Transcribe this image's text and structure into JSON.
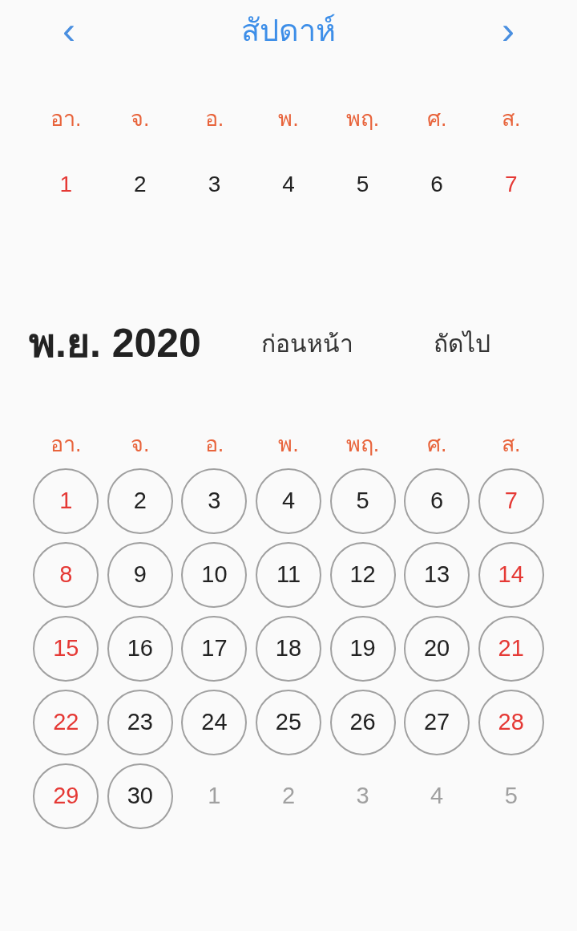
{
  "header": {
    "prev": "‹",
    "title": "สัปดาห์",
    "next": "›"
  },
  "week": {
    "weekdays": [
      "อา.",
      "จ.",
      "อ.",
      "พ.",
      "พฤ.",
      "ศ.",
      "ส."
    ],
    "days": [
      {
        "label": "1",
        "weekend": true
      },
      {
        "label": "2",
        "weekend": false
      },
      {
        "label": "3",
        "weekend": false
      },
      {
        "label": "4",
        "weekend": false
      },
      {
        "label": "5",
        "weekend": false
      },
      {
        "label": "6",
        "weekend": false
      },
      {
        "label": "7",
        "weekend": true
      }
    ]
  },
  "month": {
    "title": "พ.ย. 2020",
    "prev_button": "ก่อนหน้า",
    "next_button": "ถัดไป",
    "weekdays": [
      "อา.",
      "จ.",
      "อ.",
      "พ.",
      "พฤ.",
      "ศ.",
      "ส."
    ],
    "days": [
      {
        "label": "1",
        "weekend": true,
        "in_month": true
      },
      {
        "label": "2",
        "weekend": false,
        "in_month": true
      },
      {
        "label": "3",
        "weekend": false,
        "in_month": true
      },
      {
        "label": "4",
        "weekend": false,
        "in_month": true
      },
      {
        "label": "5",
        "weekend": false,
        "in_month": true
      },
      {
        "label": "6",
        "weekend": false,
        "in_month": true
      },
      {
        "label": "7",
        "weekend": true,
        "in_month": true
      },
      {
        "label": "8",
        "weekend": true,
        "in_month": true
      },
      {
        "label": "9",
        "weekend": false,
        "in_month": true
      },
      {
        "label": "10",
        "weekend": false,
        "in_month": true
      },
      {
        "label": "11",
        "weekend": false,
        "in_month": true
      },
      {
        "label": "12",
        "weekend": false,
        "in_month": true
      },
      {
        "label": "13",
        "weekend": false,
        "in_month": true
      },
      {
        "label": "14",
        "weekend": true,
        "in_month": true
      },
      {
        "label": "15",
        "weekend": true,
        "in_month": true
      },
      {
        "label": "16",
        "weekend": false,
        "in_month": true
      },
      {
        "label": "17",
        "weekend": false,
        "in_month": true
      },
      {
        "label": "18",
        "weekend": false,
        "in_month": true
      },
      {
        "label": "19",
        "weekend": false,
        "in_month": true
      },
      {
        "label": "20",
        "weekend": false,
        "in_month": true
      },
      {
        "label": "21",
        "weekend": true,
        "in_month": true
      },
      {
        "label": "22",
        "weekend": true,
        "in_month": true
      },
      {
        "label": "23",
        "weekend": false,
        "in_month": true
      },
      {
        "label": "24",
        "weekend": false,
        "in_month": true
      },
      {
        "label": "25",
        "weekend": false,
        "in_month": true
      },
      {
        "label": "26",
        "weekend": false,
        "in_month": true
      },
      {
        "label": "27",
        "weekend": false,
        "in_month": true
      },
      {
        "label": "28",
        "weekend": true,
        "in_month": true
      },
      {
        "label": "29",
        "weekend": true,
        "in_month": true
      },
      {
        "label": "30",
        "weekend": false,
        "in_month": true
      },
      {
        "label": "1",
        "in_month": false
      },
      {
        "label": "2",
        "in_month": false
      },
      {
        "label": "3",
        "in_month": false
      },
      {
        "label": "4",
        "in_month": false
      },
      {
        "label": "5",
        "in_month": false
      }
    ]
  }
}
